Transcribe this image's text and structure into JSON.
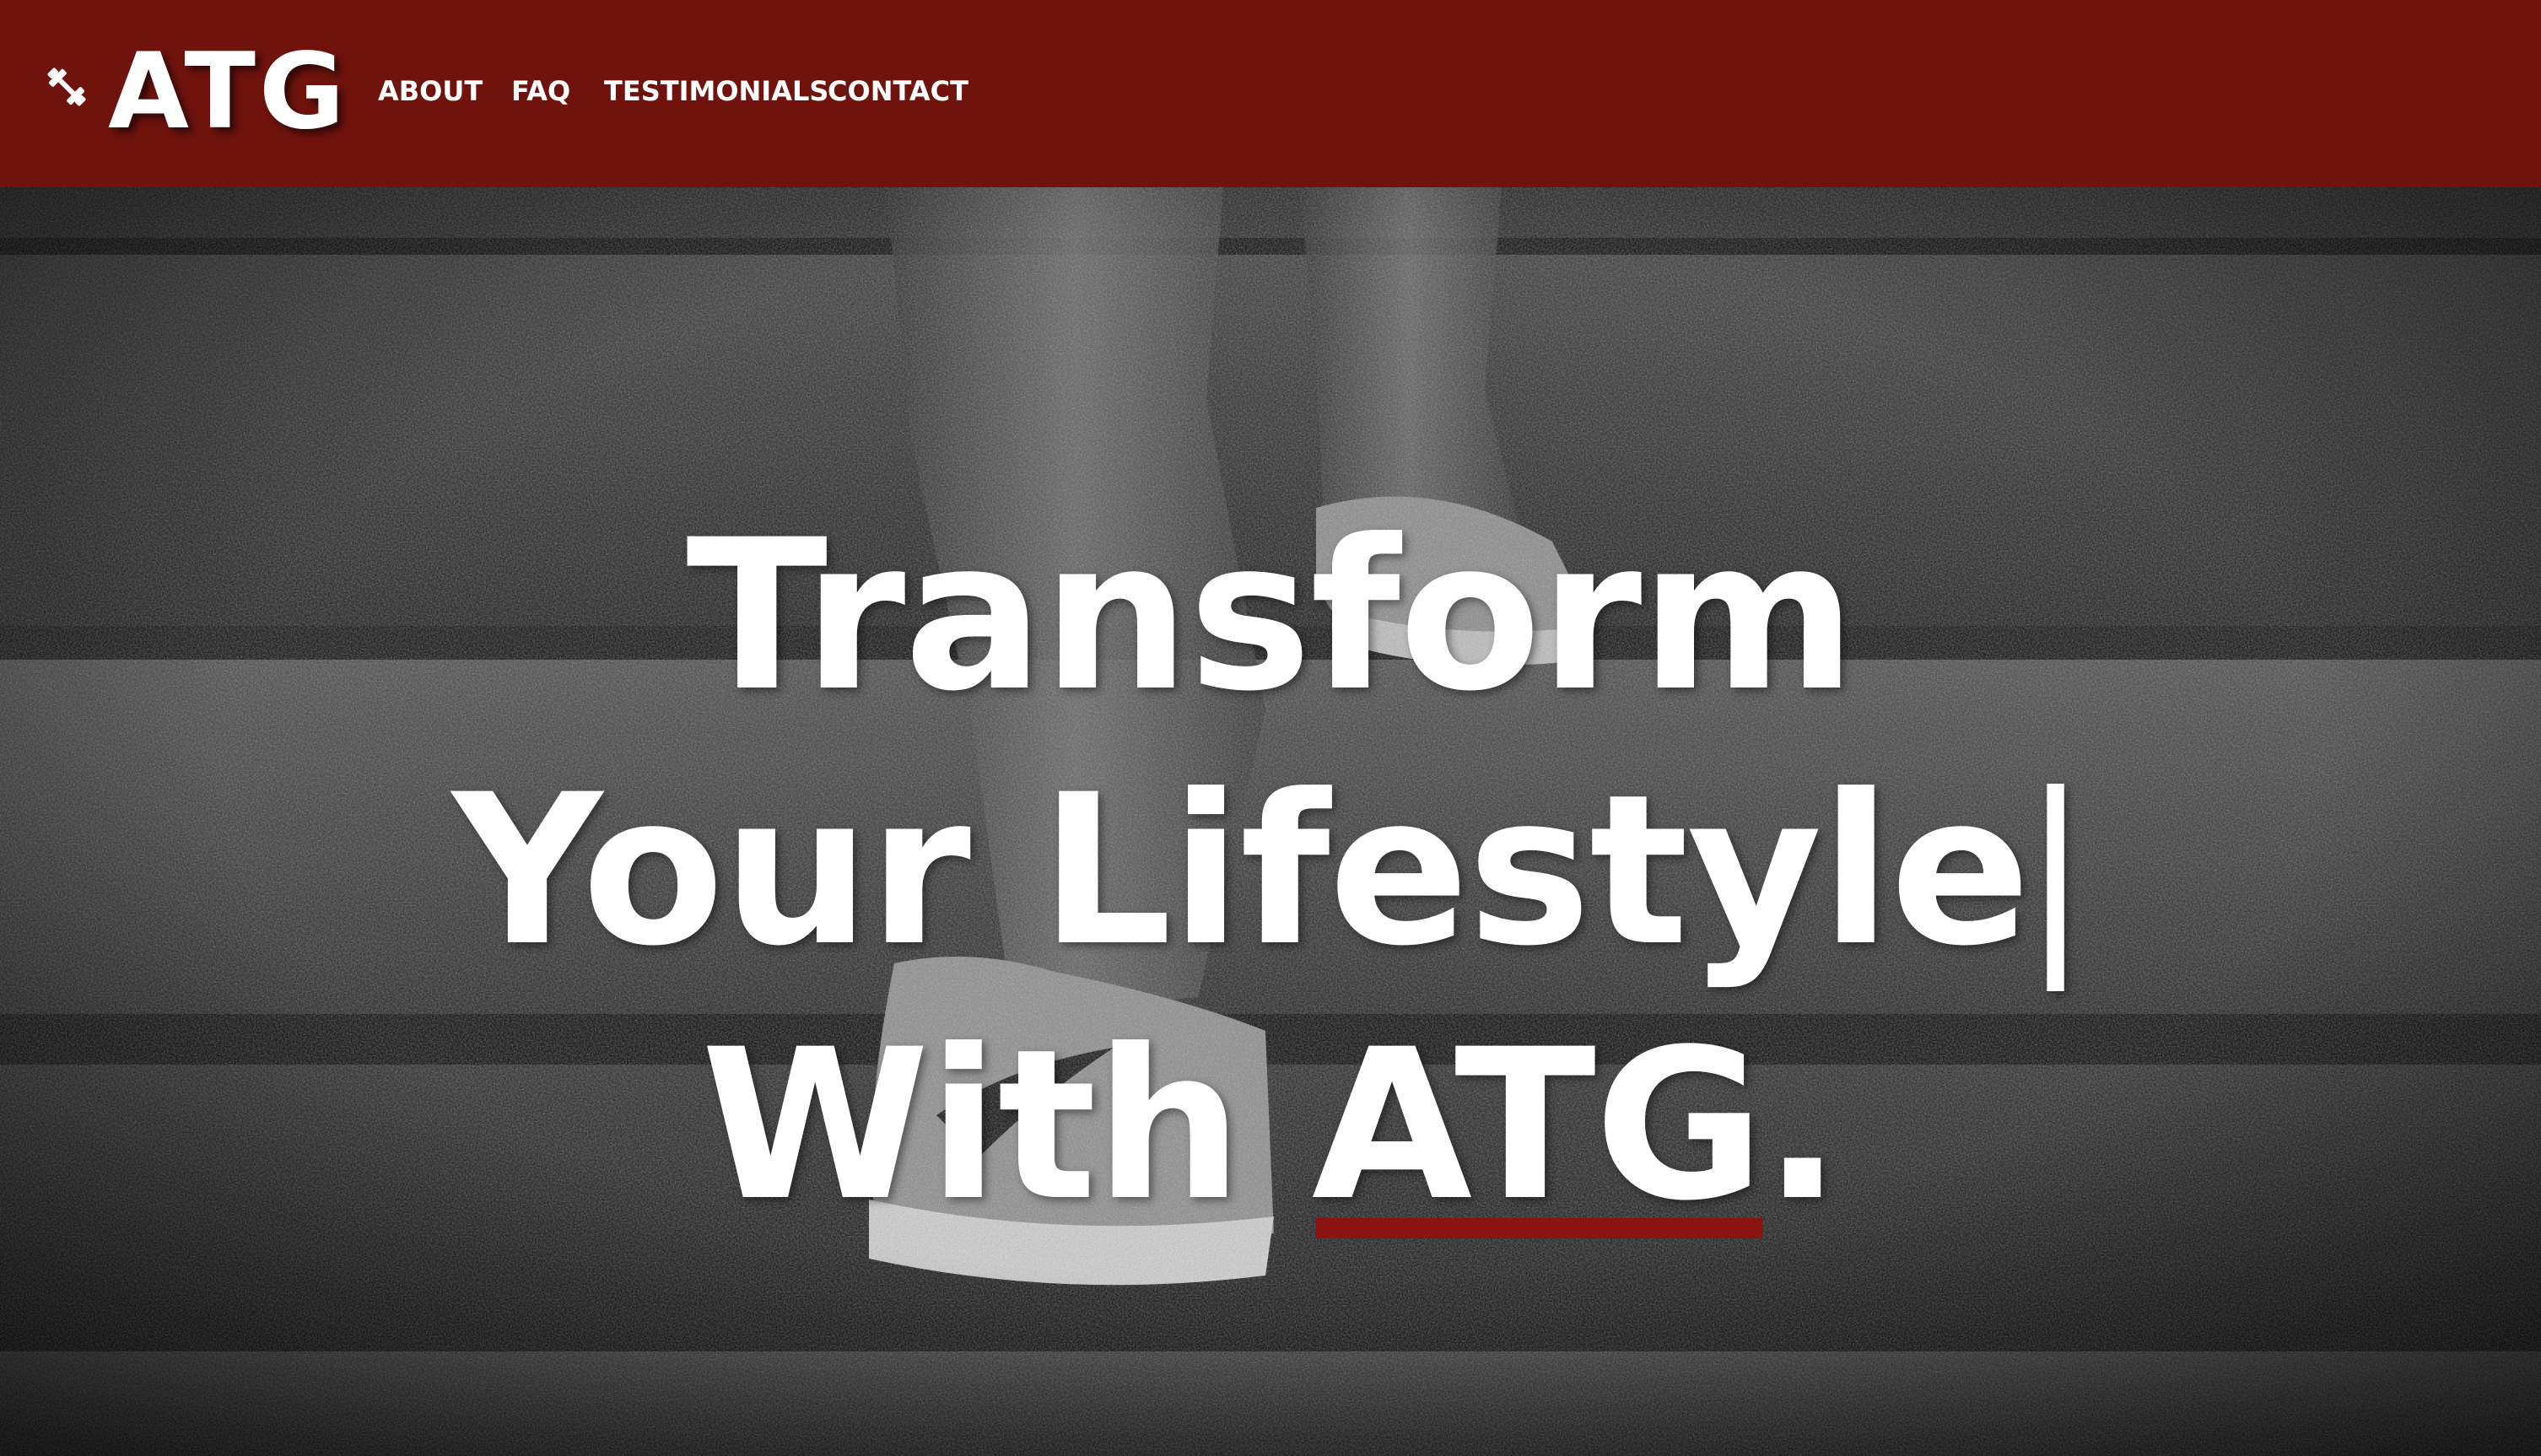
{
  "header": {
    "logo_text": "ATG",
    "logo_icon": "dumbbell-icon",
    "nav": [
      {
        "label": "ABOUT"
      },
      {
        "label": "FAQ"
      },
      {
        "label": "TESTIMONIALS"
      },
      {
        "label": "CONTACT"
      }
    ]
  },
  "hero": {
    "line1": "Transform",
    "line2": "Your Lifestyle",
    "cursor": "|",
    "line3_prefix": "With ",
    "line3_brand": "ATG",
    "line3_suffix": "."
  },
  "colors": {
    "navbar_bg": "#70130d",
    "accent_underline": "#8b1410",
    "text": "#ffffff"
  }
}
